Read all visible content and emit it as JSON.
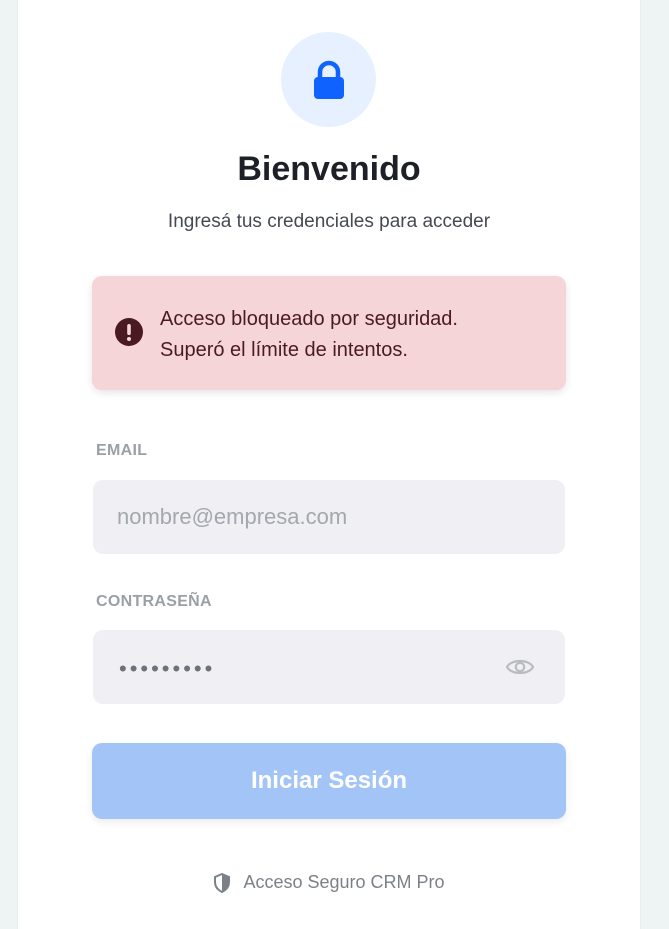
{
  "header": {
    "icon": "lock-icon",
    "title": "Bienvenido",
    "subtitle": "Ingresá tus credenciales para acceder"
  },
  "alert": {
    "icon": "alert-exclamation-icon",
    "line1": "Acceso bloqueado por seguridad.",
    "line2": "Superó el límite de intentos."
  },
  "email": {
    "label": "EMAIL",
    "placeholder": "nombre@empresa.com"
  },
  "password": {
    "label": "CONTRASEÑA",
    "value_masked": "•••••••••",
    "toggle_icon": "eye-icon"
  },
  "submit": {
    "label": "Iniciar Sesión"
  },
  "footer": {
    "icon": "shield-icon",
    "text": "Acceso Seguro CRM Pro"
  },
  "colors": {
    "accent": "#0f62fe",
    "button_disabled": "#a3c4f7",
    "alert_bg": "#f5d5d7",
    "alert_text": "#4a1a22"
  }
}
